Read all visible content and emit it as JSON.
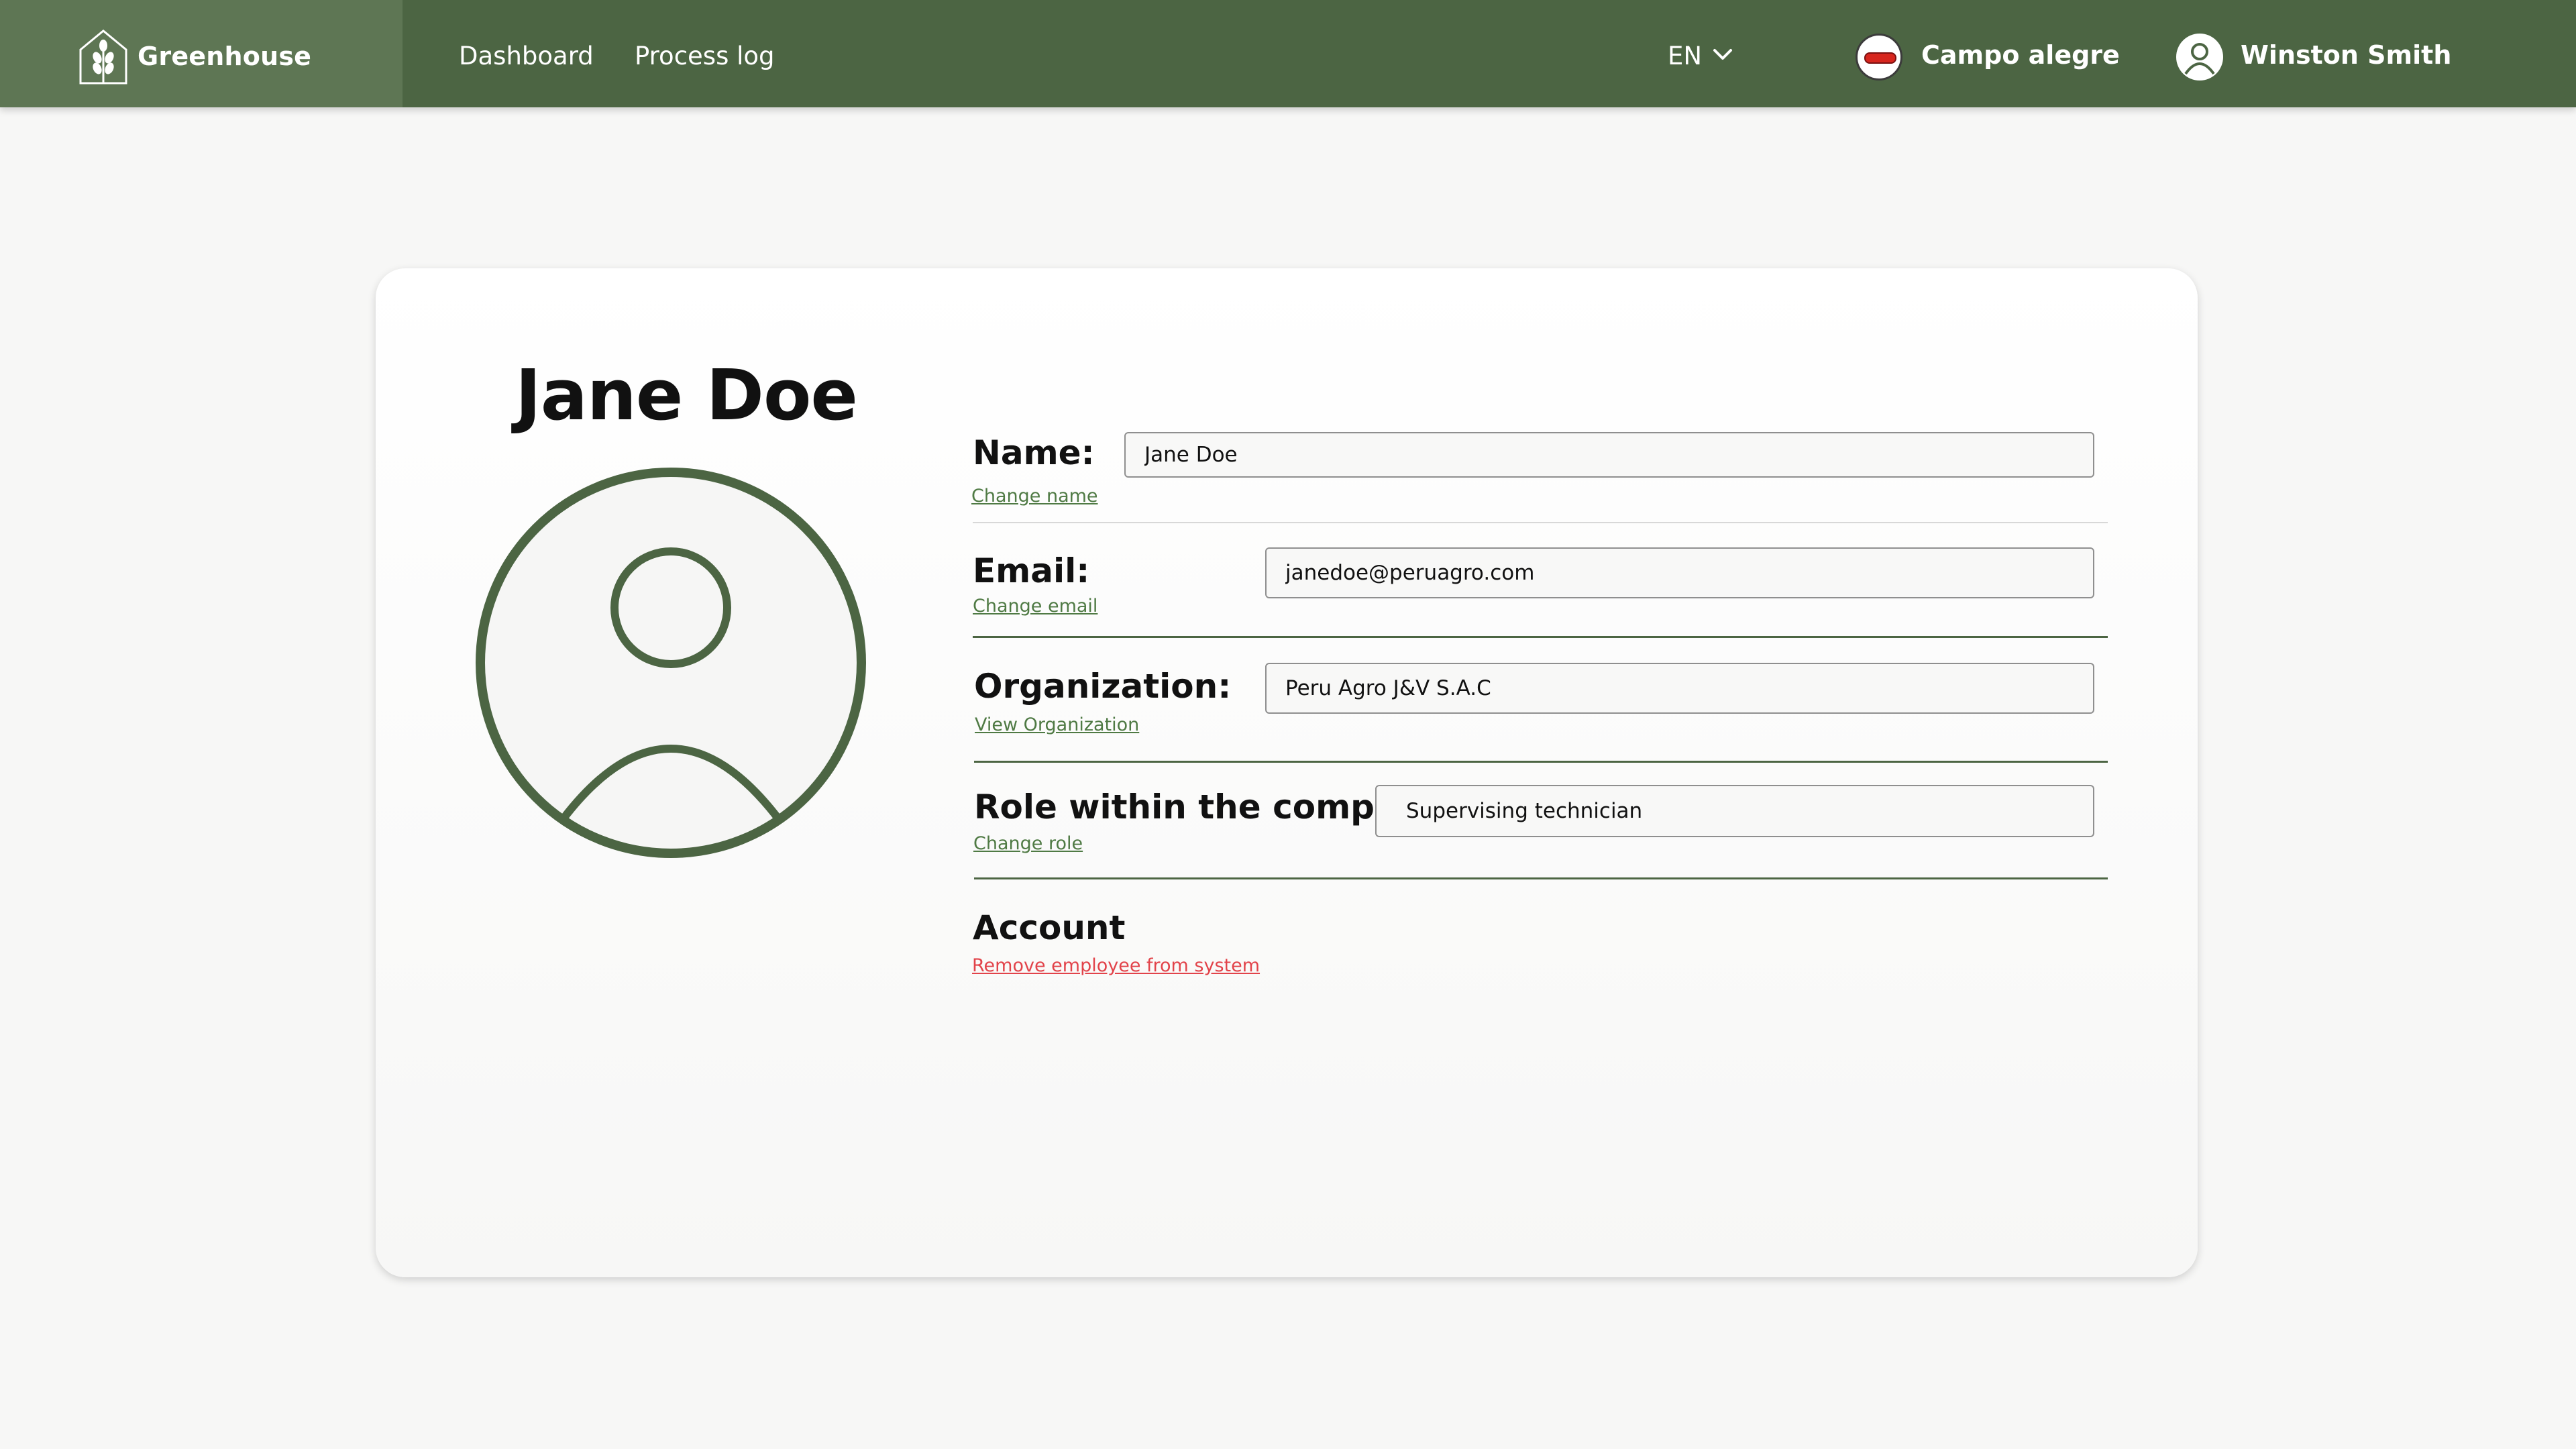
{
  "header": {
    "brand": "Greenhouse",
    "nav": [
      {
        "label": "Dashboard"
      },
      {
        "label": "Process log"
      }
    ],
    "language": "EN",
    "farm": "Campo alegre",
    "user": "Winston Smith"
  },
  "profile": {
    "title": "Jane Doe",
    "fields": {
      "name": {
        "label": "Name:",
        "value": "Jane Doe",
        "link": "Change name"
      },
      "email": {
        "label": "Email:",
        "value": "janedoe@peruagro.com",
        "link": "Change email"
      },
      "organization": {
        "label": "Organization:",
        "value": "Peru Agro J&V S.A.C",
        "link": "View Organization"
      },
      "role": {
        "label": "Role within the company:",
        "value": "Supervising technician",
        "link": "Change role"
      }
    },
    "account": {
      "title": "Account",
      "remove_link": "Remove employee from system"
    }
  },
  "colors": {
    "primary": "#4c6543",
    "brand_panel": "#5e7654",
    "link": "#4f7a44",
    "danger": "#e2434a"
  }
}
